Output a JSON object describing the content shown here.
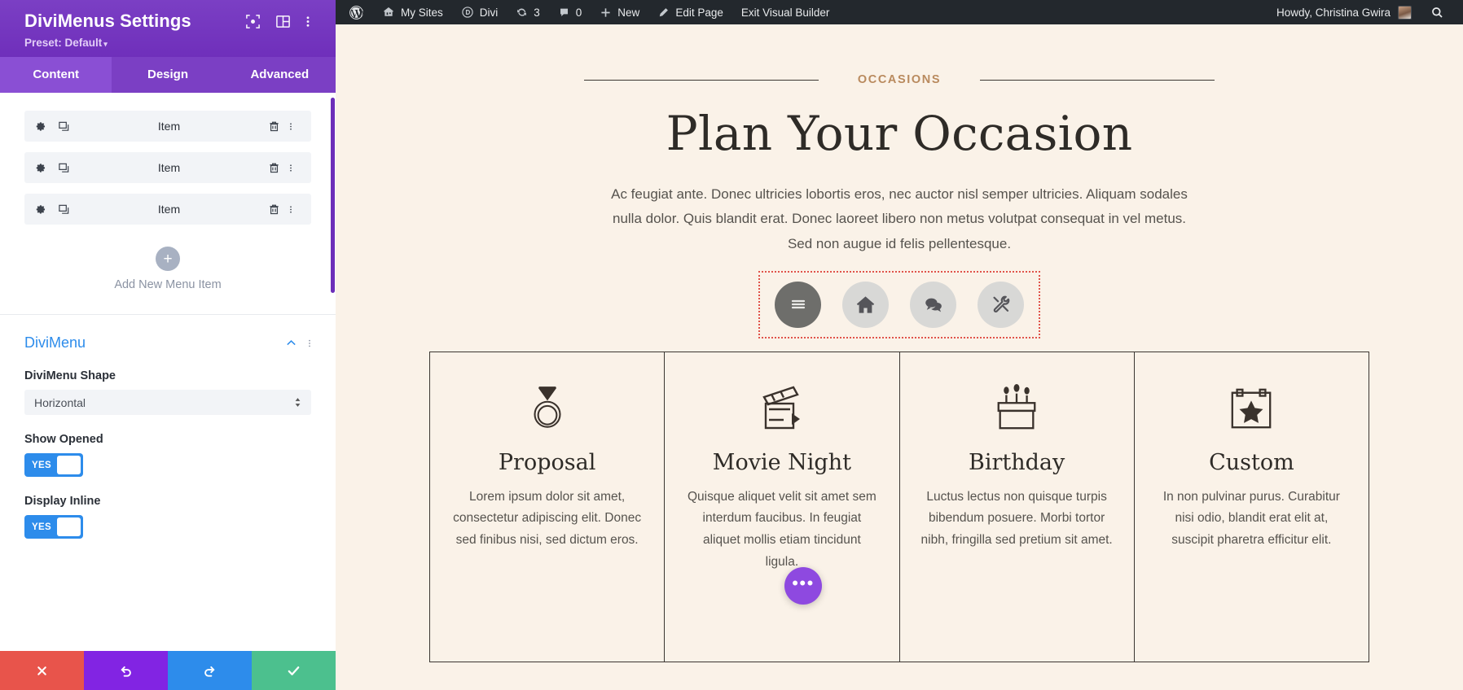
{
  "settings_panel": {
    "title": "DiviMenus Settings",
    "preset": "Preset: Default",
    "preset_caret": "▾",
    "header_icons": [
      {
        "name": "focus-icon"
      },
      {
        "name": "layout-columns-icon"
      },
      {
        "name": "vertical-dots-icon"
      }
    ],
    "tabs": [
      {
        "label": "Content",
        "active": true
      },
      {
        "label": "Design",
        "active": false
      },
      {
        "label": "Advanced",
        "active": false
      }
    ],
    "menu_items": [
      {
        "label": "Item"
      },
      {
        "label": "Item"
      },
      {
        "label": "Item"
      }
    ],
    "add_item": {
      "plus": "+",
      "label": "Add New Menu Item"
    },
    "divimenu_section": {
      "title": "DiviMenu",
      "shape_label": "DiviMenu Shape",
      "shape_value": "Horizontal",
      "show_opened_label": "Show Opened",
      "show_opened_value": "YES",
      "display_inline_label": "Display Inline",
      "display_inline_value": "YES"
    },
    "footer_buttons": [
      {
        "name": "discard-button",
        "icon": "close-icon",
        "color": "#e8544b"
      },
      {
        "name": "undo-button",
        "icon": "undo-icon",
        "color": "#8224e3"
      },
      {
        "name": "redo-button",
        "icon": "redo-icon",
        "color": "#2d8ceb"
      },
      {
        "name": "save-button",
        "icon": "check-icon",
        "color": "#4cc08e"
      }
    ],
    "colors": {
      "header_purple": "#6c2eb9",
      "tab_purple": "#7b3fc4",
      "accent_blue": "#2d8ceb"
    }
  },
  "admin_bar": {
    "wp_logo": "wordpress-logo-icon",
    "items": [
      {
        "label": "My Sites",
        "icon": "sites-icon"
      },
      {
        "label": "Divi",
        "icon": "divi-icon"
      },
      {
        "label": "3",
        "icon": "updates-icon"
      },
      {
        "label": "0",
        "icon": "comments-icon"
      },
      {
        "label": "New",
        "icon": "plus-icon"
      },
      {
        "label": "Edit Page",
        "icon": "pencil-icon"
      },
      {
        "label": "Exit Visual Builder",
        "icon": ""
      }
    ],
    "howdy": "Howdy, Christina Gwira",
    "search_icon": "search-icon"
  },
  "page": {
    "eyebrow": "OCCASIONS",
    "title": "Plan Your Occasion",
    "paragraph": "Ac feugiat ante. Donec ultricies lobortis eros, nec auctor nisl semper ultricies. Aliquam sodales nulla dolor. Quis blandit erat. Donec laoreet libero non metus volutpat consequat in vel metus. Sed non augue id felis pellentesque.",
    "icon_menu": [
      {
        "name": "hamburger-menu-icon",
        "primary": true
      },
      {
        "name": "home-icon",
        "primary": false
      },
      {
        "name": "chat-bubbles-icon",
        "primary": false
      },
      {
        "name": "tools-icon",
        "primary": false
      }
    ],
    "cards": [
      {
        "icon": "diamond-ring-icon",
        "title": "Proposal",
        "text": "Lorem ipsum dolor sit amet, consectetur adipiscing elit. Donec sed finibus nisi, sed dictum eros."
      },
      {
        "icon": "clapperboard-icon",
        "title": "Movie Night",
        "text": "Quisque aliquet velit sit amet sem interdum faucibus. In feugiat aliquet mollis etiam tincidunt ligula."
      },
      {
        "icon": "birthday-cake-icon",
        "title": "Birthday",
        "text": "Luctus lectus non quisque turpis bibendum posuere. Morbi tortor nibh, fringilla sed pretium sit amet."
      },
      {
        "icon": "calendar-star-icon",
        "title": "Custom",
        "text": "In non pulvinar purus. Curabitur nisi odio, blandit erat elit at, suscipit pharetra efficitur elit."
      }
    ],
    "fab_label": "•••",
    "colors": {
      "background": "#faf2e8",
      "eyebrow": "#b98a5e",
      "ink": "#2e2b27",
      "dotted_highlight": "#e0534a"
    }
  }
}
